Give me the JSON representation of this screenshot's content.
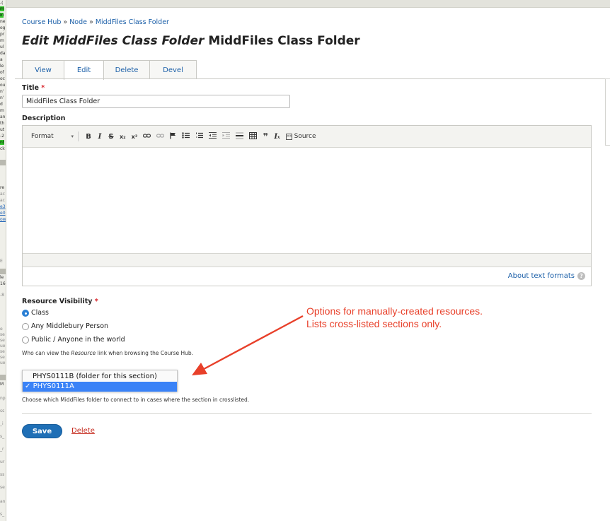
{
  "breadcrumb": {
    "items": [
      "Course Hub",
      "Node",
      "MiddFiles Class Folder"
    ],
    "separator": "»"
  },
  "page": {
    "title_italic": "Edit MiddFiles Class Folder",
    "title_rest": "MiddFiles Class Folder"
  },
  "tabs": [
    {
      "label": "View",
      "active": false
    },
    {
      "label": "Edit",
      "active": true
    },
    {
      "label": "Delete",
      "active": false
    },
    {
      "label": "Devel",
      "active": false
    }
  ],
  "title_field": {
    "label": "Title",
    "required_mark": "*",
    "value": "MiddFiles Class Folder"
  },
  "description": {
    "label": "Description",
    "toolbar": {
      "format_label": "Format",
      "format_caret": "▾",
      "bold": "B",
      "italic": "I",
      "strike": "S",
      "subscript": "x₂",
      "superscript": "x²",
      "source_label": "Source"
    },
    "about_formats": "About text formats"
  },
  "visibility": {
    "label": "Resource Visibility",
    "required_mark": "*",
    "options": [
      {
        "label": "Class",
        "checked": true
      },
      {
        "label": "Any Middlebury Person",
        "checked": false
      },
      {
        "label": "Public / Anyone in the world",
        "checked": false
      }
    ],
    "help_before": "Who can view the ",
    "help_italic": "Resource",
    "help_after": " link when browsing the Course Hub."
  },
  "folder_select": {
    "options": [
      {
        "label": "PHYS0111B (folder for this section)",
        "selected": false
      },
      {
        "label": "PHYS0111A",
        "selected": true
      }
    ],
    "check_mark": "✓",
    "help": "Choose which MiddFiles folder to connect to in cases where the section in crosslisted."
  },
  "annotation": {
    "text": "Options for manually-created resources.\nLists cross-listed sections only.",
    "color": "#e8402a"
  },
  "actions": {
    "save_label": "Save",
    "delete_label": "Delete"
  },
  "colors": {
    "link": "#1b5fa8",
    "primary_button": "#1f6fb6",
    "required": "#d8232a",
    "delete": "#c5291c"
  }
}
